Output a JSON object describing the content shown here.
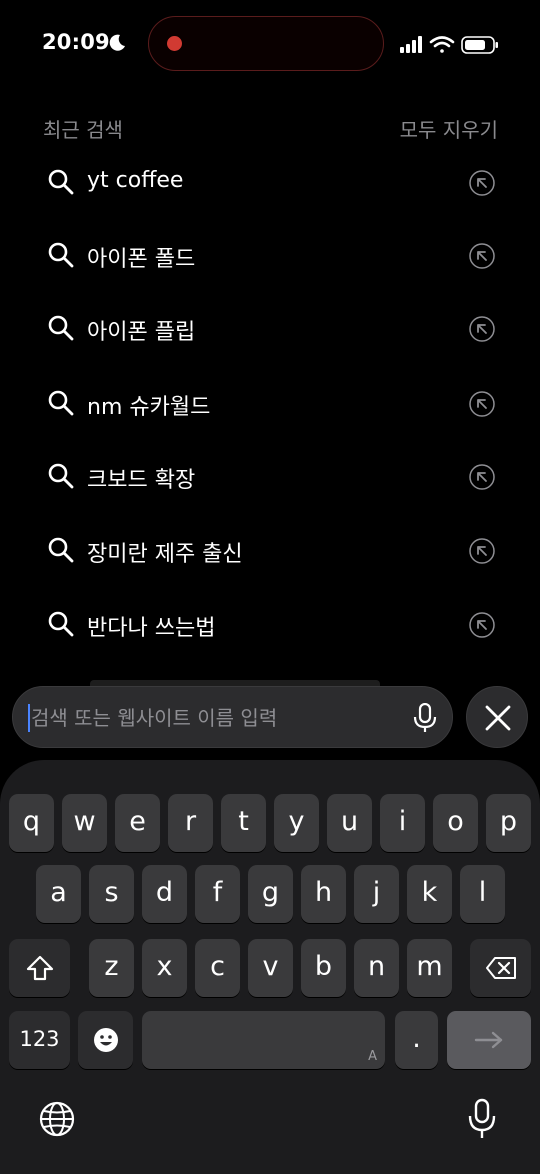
{
  "status": {
    "time": "20:09"
  },
  "recent": {
    "title": "최근 검색",
    "clear_label": "모두 지우기",
    "items": [
      {
        "label": "yt coffee"
      },
      {
        "label": "아이폰 폴드"
      },
      {
        "label": "아이폰 플립"
      },
      {
        "label": "nm 슈카월드"
      },
      {
        "label": "크보드 확장"
      },
      {
        "label": "장미란 제주 출신"
      },
      {
        "label": "반다나 쓰는법"
      }
    ]
  },
  "search": {
    "placeholder": "검색 또는 웹사이트 이름 입력",
    "value": ""
  },
  "keyboard": {
    "row1": [
      "q",
      "w",
      "e",
      "r",
      "t",
      "y",
      "u",
      "i",
      "o",
      "p"
    ],
    "row2": [
      "a",
      "s",
      "d",
      "f",
      "g",
      "h",
      "j",
      "k",
      "l"
    ],
    "row3": [
      "z",
      "x",
      "c",
      "v",
      "b",
      "n",
      "m"
    ],
    "numbers_label": "123",
    "space_hint": "A",
    "period_label": "."
  },
  "colors": {
    "accent": "#4a84ff",
    "recording": "#d13a32",
    "key": "#3a3a3c",
    "keyboard_bg": "#1c1c1e"
  },
  "icons": [
    "moon-icon",
    "cellular-signal-icon",
    "wifi-icon",
    "battery-icon",
    "search-icon",
    "arrow-up-left-icon",
    "microphone-icon",
    "close-icon",
    "shift-icon",
    "backspace-icon",
    "emoji-icon",
    "arrow-right-icon",
    "globe-icon"
  ]
}
